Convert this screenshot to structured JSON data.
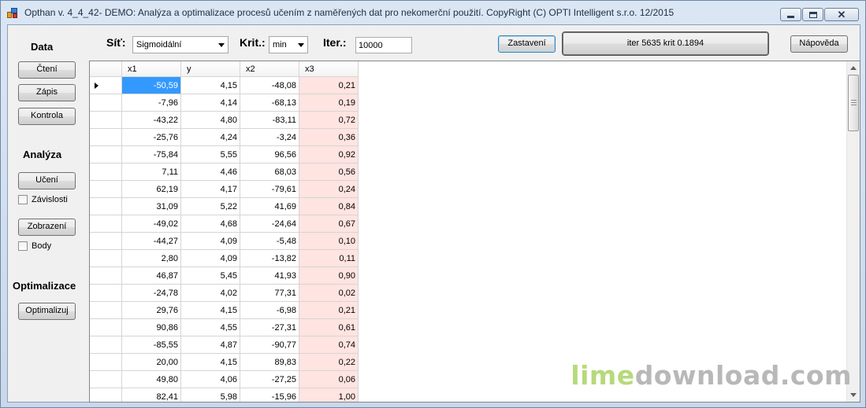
{
  "window": {
    "title": "Opthan v. 4_4_42- DEMO: Analýza a optimalizace procesů učením z naměřených dat pro nekomerční použití. CopyRight (C) OPTI Intelligent s.r.o. 12/2015"
  },
  "toolbar": {
    "sit_label": "Síť:",
    "sit_value": "Sigmoidální",
    "krit_label": "Krit.:",
    "krit_value": "min",
    "iter_label": "Iter.:",
    "iter_value": "10000",
    "stop_button": "Zastavení",
    "status_text": "iter 5635 krit 0.1894",
    "help_button": "Nápověda"
  },
  "sidebar": {
    "data_title": "Data",
    "read_button": "Čtení",
    "write_button": "Zápis",
    "check_button": "Kontrola",
    "analysis_title": "Analýza",
    "learn_button": "Učení",
    "dependencies_label": "Závislosti",
    "display_button": "Zobrazení",
    "points_label": "Body",
    "optimization_title": "Optimalizace",
    "optimize_button": "Optimalizuj"
  },
  "grid": {
    "columns": [
      "x1",
      "y",
      "x2",
      "x3"
    ],
    "rows": [
      [
        "-50,59",
        "4,15",
        "-48,08",
        "0,21"
      ],
      [
        "-7,96",
        "4,14",
        "-68,13",
        "0,19"
      ],
      [
        "-43,22",
        "4,80",
        "-83,11",
        "0,72"
      ],
      [
        "-25,76",
        "4,24",
        "-3,24",
        "0,36"
      ],
      [
        "-75,84",
        "5,55",
        "96,56",
        "0,92"
      ],
      [
        "7,11",
        "4,46",
        "68,03",
        "0,56"
      ],
      [
        "62,19",
        "4,17",
        "-79,61",
        "0,24"
      ],
      [
        "31,09",
        "5,22",
        "41,69",
        "0,84"
      ],
      [
        "-49,02",
        "4,68",
        "-24,64",
        "0,67"
      ],
      [
        "-44,27",
        "4,09",
        "-5,48",
        "0,10"
      ],
      [
        "2,80",
        "4,09",
        "-13,82",
        "0,11"
      ],
      [
        "46,87",
        "5,45",
        "41,93",
        "0,90"
      ],
      [
        "-24,78",
        "4,02",
        "77,31",
        "0,02"
      ],
      [
        "29,76",
        "4,15",
        "-6,98",
        "0,21"
      ],
      [
        "90,86",
        "4,55",
        "-27,31",
        "0,61"
      ],
      [
        "-85,55",
        "4,87",
        "-90,77",
        "0,74"
      ],
      [
        "20,00",
        "4,15",
        "89,83",
        "0,22"
      ],
      [
        "49,80",
        "4,06",
        "-27,25",
        "0,06"
      ],
      [
        "82,41",
        "5,98",
        "-15,96",
        "1,00"
      ]
    ]
  },
  "watermark": {
    "part1": "lime",
    "part2": "download.com"
  },
  "colors": {
    "highlight_column": "#ffe4e1",
    "selection": "#3399ff"
  }
}
